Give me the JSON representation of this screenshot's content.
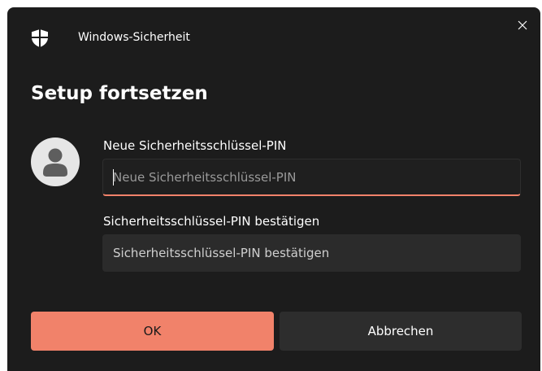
{
  "window": {
    "app_title": "Windows-Sicherheit",
    "close_icon": "close-icon",
    "app_icon": "shield-icon"
  },
  "dialog": {
    "heading": "Setup fortsetzen",
    "avatar_icon": "user-icon"
  },
  "fields": {
    "new_pin": {
      "label": "Neue Sicherheitsschlüssel-PIN",
      "placeholder": "Neue Sicherheitsschlüssel-PIN",
      "value": ""
    },
    "confirm_pin": {
      "label": "Sicherheitsschlüssel-PIN bestätigen",
      "placeholder": "Sicherheitsschlüssel-PIN bestätigen",
      "value": ""
    }
  },
  "buttons": {
    "ok_label": "OK",
    "cancel_label": "Abbrechen"
  },
  "colors": {
    "accent": "#f1826a",
    "background": "#1c1c1c",
    "input_background": "#2b2b2b",
    "secondary_button": "#2d2d2d"
  }
}
